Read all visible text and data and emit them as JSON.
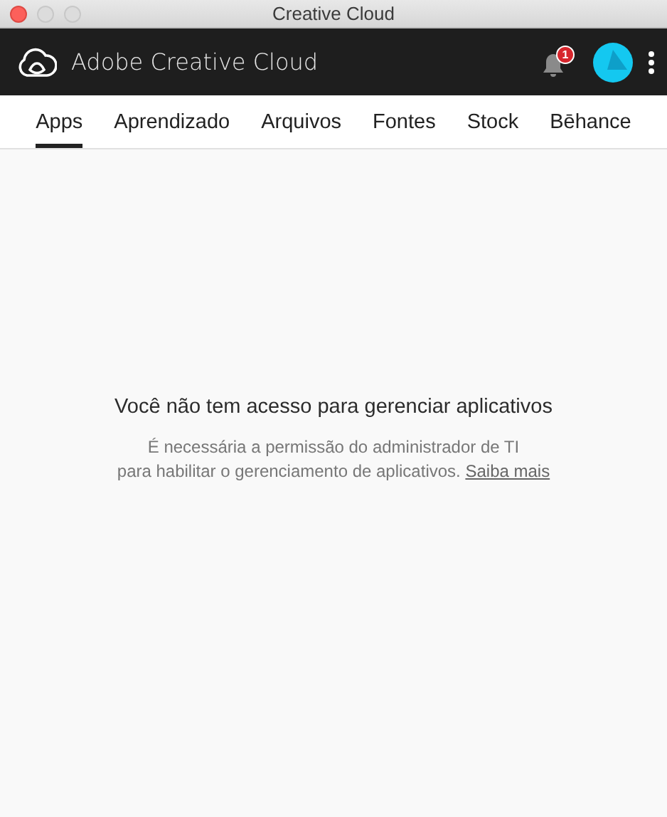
{
  "window": {
    "title": "Creative Cloud"
  },
  "header": {
    "app_name": "Adobe Creative Cloud",
    "notification_count": "1"
  },
  "tabs": [
    {
      "label": "Apps",
      "selected": true
    },
    {
      "label": "Aprendizado",
      "selected": false
    },
    {
      "label": "Arquivos",
      "selected": false
    },
    {
      "label": "Fontes",
      "selected": false
    },
    {
      "label": "Stock",
      "selected": false
    },
    {
      "label": "Bēhance",
      "selected": false
    }
  ],
  "message": {
    "title": "Você não tem acesso para gerenciar aplicativos",
    "lines": [
      "É necessária a permissão do administrador de TI",
      "para habilitar o gerenciamento de aplicativos."
    ],
    "link": "Saiba mais"
  }
}
